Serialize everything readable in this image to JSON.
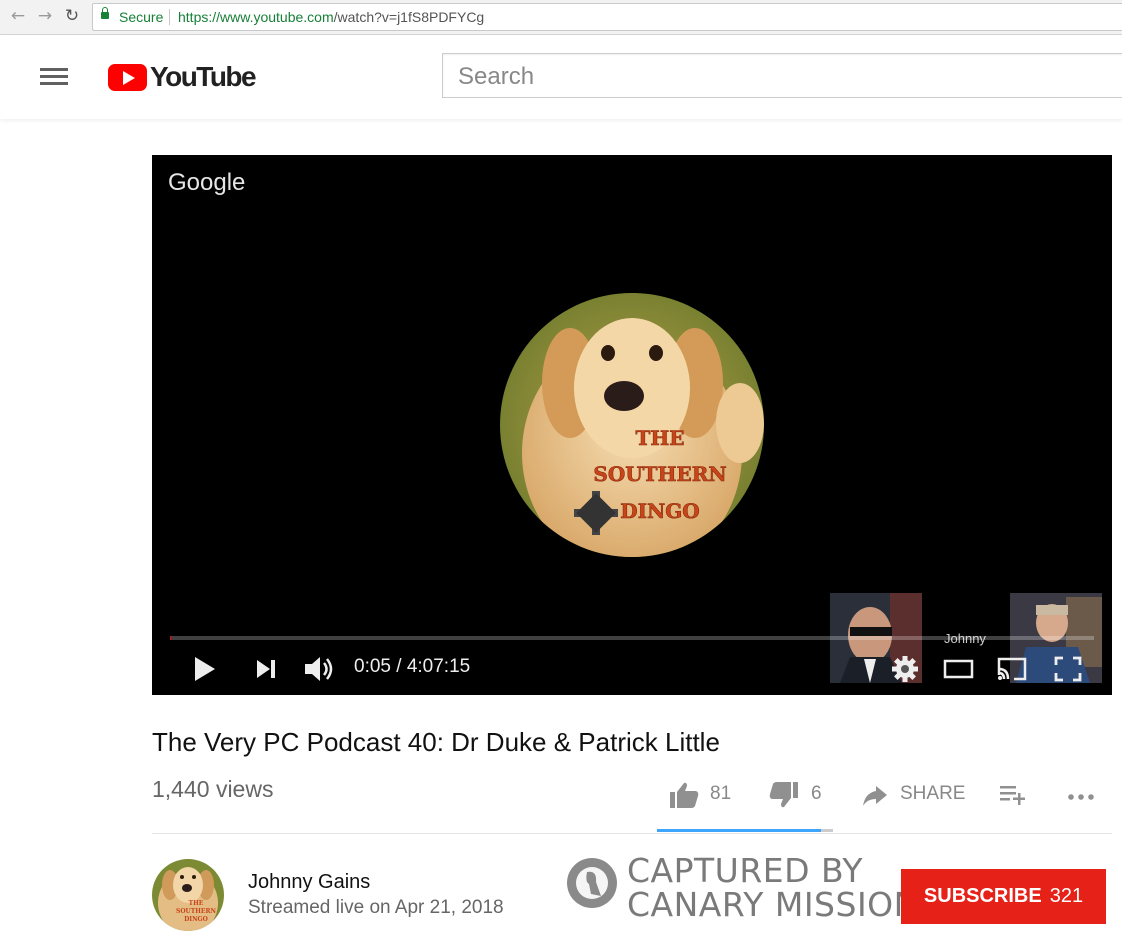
{
  "browser": {
    "back_icon": "arrow-left-icon",
    "forward_icon": "arrow-right-icon",
    "reload_icon": "reload-icon",
    "secure_label": "Secure",
    "url_host": "https://www.youtube.com",
    "url_path": "/watch?v=j1fS8PDFYCg"
  },
  "header": {
    "logo_text": "YouTube",
    "search_placeholder": "Search"
  },
  "player": {
    "watermark": "Google",
    "badge_lines": [
      "THE",
      "SOUTHERN",
      "DINGO"
    ],
    "time": "0:05 / 4:07:15",
    "progress_fraction": 0.0003,
    "thumb_name": "Johnny"
  },
  "video": {
    "title": "The Very PC Podcast 40: Dr Duke & Patrick Little",
    "views": "1,440 views",
    "likes": "81",
    "dislikes": "6",
    "share_label": "SHARE",
    "like_ratio": 0.931
  },
  "channel": {
    "name": "Johnny Gains",
    "streamed": "Streamed live on Apr 21, 2018",
    "subscribe_label": "SUBSCRIBE",
    "subscriber_count": "321"
  },
  "overlay": {
    "line1": "CAPTURED BY",
    "line2": "CANARY MISSION"
  },
  "colors": {
    "accent": "#e62117",
    "logo_red": "#ff0000",
    "secure_green": "#188038",
    "sentiment_blue": "#3ea6ff"
  }
}
